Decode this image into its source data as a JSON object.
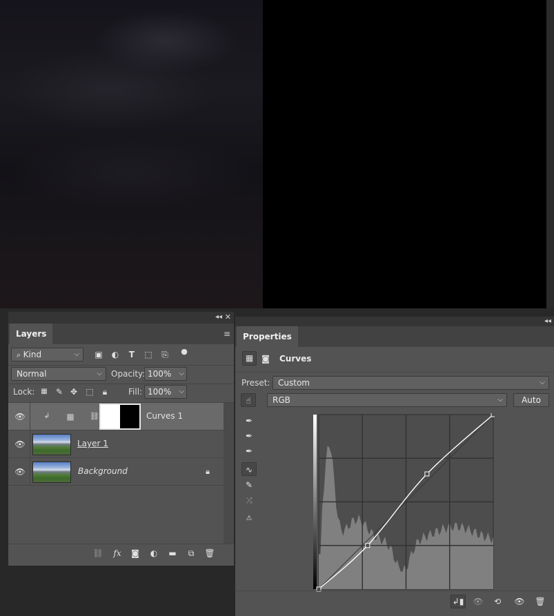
{
  "layers_panel": {
    "tab": "Layers",
    "filter": {
      "value": "Kind"
    },
    "blend_mode": "Normal",
    "opacity_label": "Opacity:",
    "opacity_value": "100%",
    "lock_label": "Lock:",
    "fill_label": "Fill:",
    "fill_value": "100%",
    "layers": [
      {
        "name": "Curves 1",
        "selected": true
      },
      {
        "name": "Layer 1",
        "selected": false
      },
      {
        "name": "Background",
        "selected": false,
        "locked": true
      }
    ]
  },
  "properties_panel": {
    "tab": "Properties",
    "adjustment_title": "Curves",
    "preset_label": "Preset:",
    "preset_value": "Custom",
    "channel_value": "RGB",
    "auto_label": "Auto"
  },
  "curve": {
    "points": [
      [
        0,
        0
      ],
      [
        28,
        25
      ],
      [
        62,
        66
      ],
      [
        100,
        100
      ]
    ],
    "curve_color": "#ffffff",
    "histogram_color": "#8a8a8a"
  }
}
